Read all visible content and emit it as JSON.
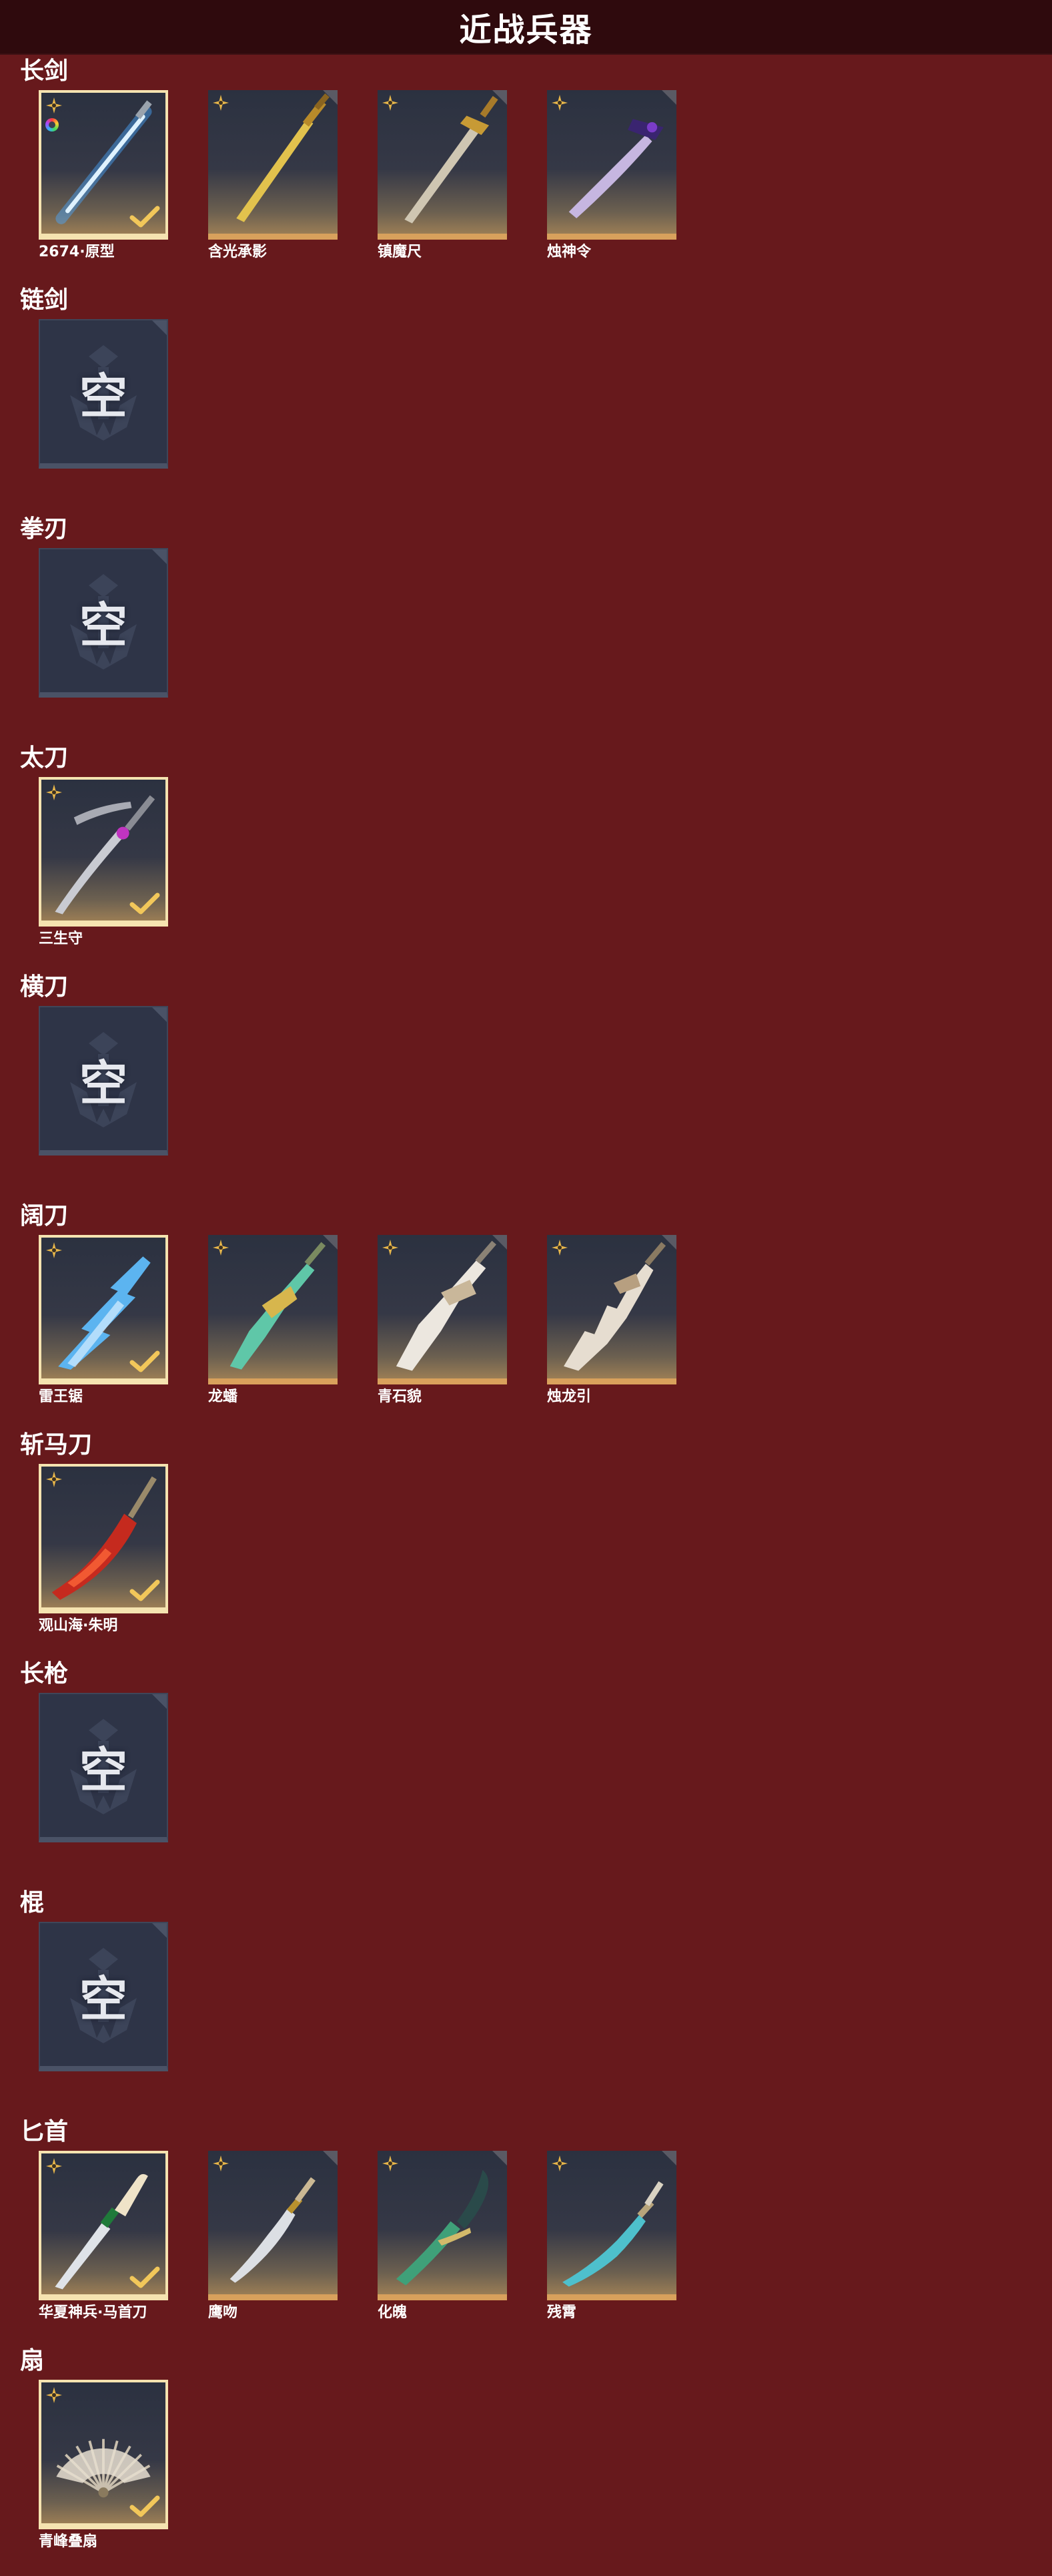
{
  "header": {
    "title": "近战兵器"
  },
  "labels": {
    "empty": "空"
  },
  "colors": {
    "background": "#67191c",
    "header": "#2f0a0d",
    "card_bottom_border": "#d9a15c",
    "selected_border": "#f5e3b0",
    "empty_card": "#2e3447",
    "check": "#f2c75a"
  },
  "icons": {
    "rarity": "gold-four-point-star-icon",
    "selected": "checkmark-icon",
    "color_variant": "rainbow-ring-icon",
    "corner": "corner-tab-icon",
    "empty_emblem": "anchor-emblem-icon"
  },
  "sections": [
    {
      "title": "长剑",
      "items": [
        {
          "name": "2674·原型",
          "selected": true,
          "has_color_ring": true,
          "art": "blue-energy-sword"
        },
        {
          "name": "含光承影",
          "selected": false,
          "art": "golden-sword"
        },
        {
          "name": "镇魔尺",
          "selected": false,
          "art": "ornate-gold-sword"
        },
        {
          "name": "烛神令",
          "selected": false,
          "art": "purple-curved-sword"
        }
      ]
    },
    {
      "title": "链剑",
      "empty": true,
      "items": []
    },
    {
      "title": "拳刃",
      "empty": true,
      "items": []
    },
    {
      "title": "太刀",
      "items": [
        {
          "name": "三生守",
          "selected": true,
          "art": "silver-katana"
        }
      ]
    },
    {
      "title": "横刀",
      "empty": true,
      "items": []
    },
    {
      "title": "阔刀",
      "items": [
        {
          "name": "雷王锯",
          "selected": true,
          "art": "blue-lightning-broadsword"
        },
        {
          "name": "龙蟠",
          "selected": false,
          "art": "jade-gold-broadsword"
        },
        {
          "name": "青石貌",
          "selected": false,
          "art": "white-broadsword"
        },
        {
          "name": "烛龙引",
          "selected": false,
          "art": "pale-spiked-broadsword"
        }
      ]
    },
    {
      "title": "斩马刀",
      "items": [
        {
          "name": "观山海·朱明",
          "selected": true,
          "art": "red-fire-blade"
        }
      ]
    },
    {
      "title": "长枪",
      "empty": true,
      "items": []
    },
    {
      "title": "棍",
      "empty": true,
      "items": []
    },
    {
      "title": "匕首",
      "items": [
        {
          "name": "华夏神兵·马首刀",
          "selected": true,
          "art": "horse-head-dagger"
        },
        {
          "name": "鹰吻",
          "selected": false,
          "art": "curved-silver-dagger"
        },
        {
          "name": "化魄",
          "selected": false,
          "art": "jade-claw-dagger"
        },
        {
          "name": "残霄",
          "selected": false,
          "art": "teal-curved-dagger"
        }
      ]
    },
    {
      "title": "扇",
      "items": [
        {
          "name": "青峰叠扇",
          "selected": true,
          "art": "folding-fan"
        }
      ]
    }
  ]
}
